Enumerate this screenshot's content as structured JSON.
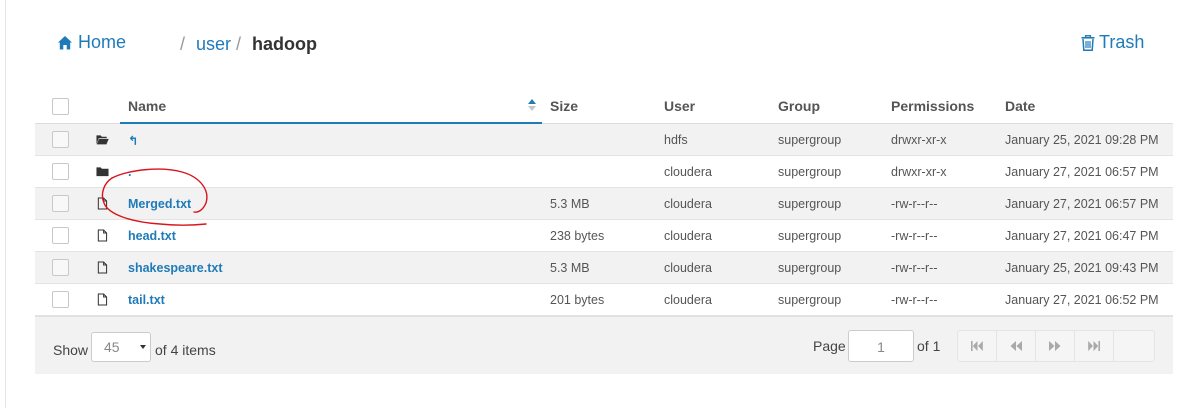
{
  "breadcrumb": {
    "home_label": "Home",
    "separator": "/",
    "path": [
      "user",
      "hadoop"
    ]
  },
  "trash_label": "Trash",
  "columns": {
    "name": "Name",
    "size": "Size",
    "user": "User",
    "group": "Group",
    "permissions": "Permissions",
    "date": "Date"
  },
  "rows": [
    {
      "icon": "folder-open-icon",
      "name": "↰",
      "size": "",
      "user": "hdfs",
      "group": "supergroup",
      "permissions": "drwxr-xr-x",
      "date": "January 25, 2021 09:28 PM"
    },
    {
      "icon": "folder-icon",
      "name": ".",
      "size": "",
      "user": "cloudera",
      "group": "supergroup",
      "permissions": "drwxr-xr-x",
      "date": "January 27, 2021 06:57 PM"
    },
    {
      "icon": "file-icon",
      "name": "Merged.txt",
      "size": "5.3 MB",
      "user": "cloudera",
      "group": "supergroup",
      "permissions": "-rw-r--r--",
      "date": "January 27, 2021 06:57 PM"
    },
    {
      "icon": "file-icon",
      "name": "head.txt",
      "size": "238 bytes",
      "user": "cloudera",
      "group": "supergroup",
      "permissions": "-rw-r--r--",
      "date": "January 27, 2021 06:47 PM"
    },
    {
      "icon": "file-icon",
      "name": "shakespeare.txt",
      "size": "5.3 MB",
      "user": "cloudera",
      "group": "supergroup",
      "permissions": "-rw-r--r--",
      "date": "January 25, 2021 09:43 PM"
    },
    {
      "icon": "file-icon",
      "name": "tail.txt",
      "size": "201 bytes",
      "user": "cloudera",
      "group": "supergroup",
      "permissions": "-rw-r--r--",
      "date": "January 27, 2021 06:52 PM"
    }
  ],
  "footer": {
    "show_label": "Show",
    "per_page": "45",
    "of_items": "of 4 items",
    "page_label": "Page",
    "page_value": "1",
    "of_pages": "of 1"
  },
  "colors": {
    "link": "#1f7bb8",
    "annotation": "#d9141b",
    "row_alt": "#f2f2f2"
  }
}
